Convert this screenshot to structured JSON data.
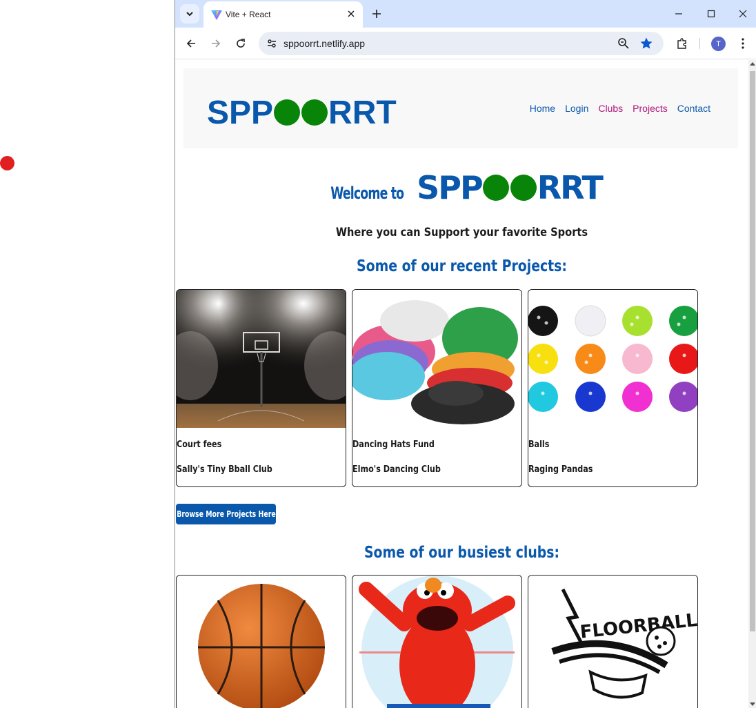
{
  "browser": {
    "tab_title": "Vite + React",
    "url": "sppoorrt.netlify.app",
    "avatar_letter": "T"
  },
  "site": {
    "logo_left": "SPP",
    "logo_right": "RRT",
    "nav": [
      {
        "label": "Home",
        "color": "#0a58ac"
      },
      {
        "label": "Login",
        "color": "#0a58ac"
      },
      {
        "label": "Clubs",
        "color": "#b0157a"
      },
      {
        "label": "Projects",
        "color": "#b0157a"
      },
      {
        "label": "Contact",
        "color": "#0a58ac"
      }
    ],
    "welcome_prefix": "Welcome to",
    "tagline": "Where you can Support your favorite Sports",
    "projects_heading": "Some of our recent Projects:",
    "clubs_heading": "Some of our busiest clubs:",
    "browse_button": "Browse More Projects Here"
  },
  "projects": [
    {
      "title": "Court fees",
      "club": "Sally's Tiny Bball Club",
      "image": "basketball-court"
    },
    {
      "title": "Dancing Hats Fund",
      "club": "Elmo's Dancing Club",
      "image": "sequin-hats"
    },
    {
      "title": "Balls",
      "club": "Raging Pandas",
      "image": "pickleballs"
    }
  ],
  "clubs": [
    {
      "image": "basketball"
    },
    {
      "image": "elmo-dancing"
    },
    {
      "image": "floorball-logo"
    }
  ],
  "colors": {
    "brand_blue": "#0a58ac",
    "brand_green": "#088408",
    "nav_active": "#b0157a"
  }
}
